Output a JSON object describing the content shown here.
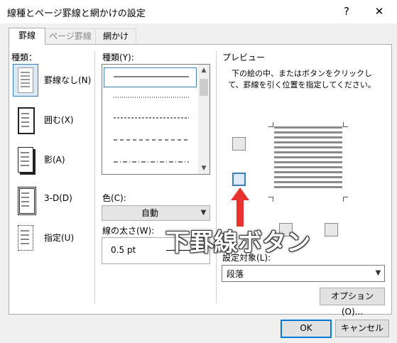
{
  "window": {
    "title": "線種とページ罫線と網かけの設定",
    "help_label": "?",
    "close_label": "✕"
  },
  "tabs": [
    {
      "label": "罫線",
      "active": true
    },
    {
      "label": "ページ罫線",
      "active": false
    },
    {
      "label": "網かけ",
      "active": false
    }
  ],
  "settings": {
    "heading": "種類：",
    "items": [
      {
        "label": "罫線なし(N)",
        "selected": true
      },
      {
        "label": "囲む(X)",
        "selected": false
      },
      {
        "label": "影(A)",
        "selected": false
      },
      {
        "label": "3-D(D)",
        "selected": false
      },
      {
        "label": "指定(U)",
        "selected": false
      }
    ]
  },
  "style": {
    "heading": "種類(Y):",
    "line_styles": [
      "solid",
      "dotted",
      "dashed-small",
      "dashed",
      "dash-dot"
    ]
  },
  "color": {
    "label": "色(C):",
    "value": "自動"
  },
  "width": {
    "label": "線の太さ(W):",
    "value": "0.5 pt"
  },
  "preview": {
    "heading": "プレビュー",
    "instructions": "下の絵の中、またはボタンをクリックして、罫線を引く位置を指定してください。"
  },
  "apply_to": {
    "label": "設定対象(L):",
    "value": "段落"
  },
  "buttons": {
    "options": "オプション(O)...",
    "ok": "OK",
    "cancel": "キャンセル"
  },
  "annotation": {
    "text": "下罫線ボタン",
    "color": "#e8322f"
  }
}
